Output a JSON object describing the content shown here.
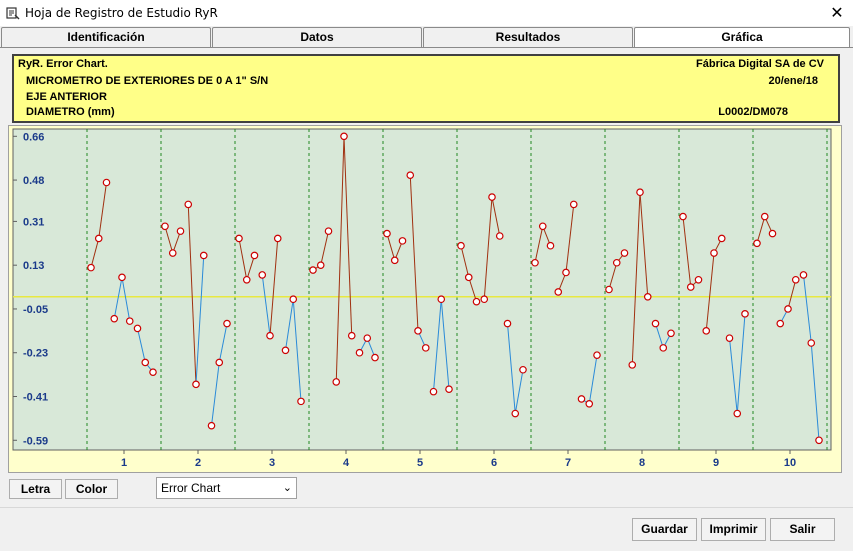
{
  "window": {
    "title": "Hoja de Registro de Estudio RyR",
    "close_glyph": "✕"
  },
  "tabs": [
    {
      "label": "Identificación",
      "active": false
    },
    {
      "label": "Datos",
      "active": false
    },
    {
      "label": "Resultados",
      "active": false
    },
    {
      "label": "Gráfica",
      "active": true
    }
  ],
  "header": {
    "chart_name": "RyR. Error Chart.",
    "company": "Fábrica Digital SA de CV",
    "instrument": "MICROMETRO DE EXTERIORES DE 0 A 1\" S/N",
    "date": "20/ene/18",
    "part": "EJE ANTERIOR",
    "characteristic": "DIAMETRO (mm)",
    "code": "L0002/DM078"
  },
  "chart_data": {
    "type": "line",
    "ylim": [
      -0.63,
      0.69
    ],
    "y_ticks": [
      "0.66",
      "0.48",
      "0.31",
      "0.13",
      "-0.05",
      "-0.23",
      "-0.41",
      "-0.59"
    ],
    "y_tick_values": [
      0.66,
      0.48,
      0.31,
      0.13,
      -0.05,
      -0.23,
      -0.41,
      -0.59
    ],
    "categories": [
      "1",
      "2",
      "3",
      "4",
      "5",
      "6",
      "7",
      "8",
      "9",
      "10"
    ],
    "center_line": 0.0,
    "colors": {
      "upper": "#a03010",
      "lower": "#2a8ad8",
      "marker": "#cc0000",
      "center": "#e8e840",
      "divider": "#228822",
      "plot_bg": "#d8e8d8",
      "outer_bg": "#ffffcc"
    },
    "parts": [
      {
        "part": "1",
        "operators": [
          [
            0.12,
            0.24,
            0.47
          ],
          [
            -0.09,
            0.08,
            -0.1
          ],
          [
            -0.13,
            -0.27,
            -0.31
          ]
        ]
      },
      {
        "part": "2",
        "operators": [
          [
            0.29,
            0.18,
            0.27
          ],
          [
            0.38,
            -0.36,
            0.17
          ],
          [
            -0.53,
            -0.27,
            -0.11
          ]
        ]
      },
      {
        "part": "3",
        "operators": [
          [
            0.24,
            0.07,
            0.17
          ],
          [
            0.09,
            -0.16,
            0.24
          ],
          [
            -0.22,
            -0.01,
            -0.43
          ]
        ]
      },
      {
        "part": "4",
        "operators": [
          [
            0.11,
            0.13,
            0.27
          ],
          [
            -0.35,
            0.66,
            -0.16
          ],
          [
            -0.23,
            -0.17,
            -0.25
          ]
        ]
      },
      {
        "part": "5",
        "operators": [
          [
            0.26,
            0.15,
            0.23
          ],
          [
            0.5,
            -0.14,
            -0.21
          ],
          [
            -0.39,
            -0.01,
            -0.38
          ]
        ]
      },
      {
        "part": "6",
        "operators": [
          [
            0.21,
            0.08,
            -0.02
          ],
          [
            -0.01,
            0.41,
            0.25
          ],
          [
            -0.11,
            -0.48,
            -0.3
          ]
        ]
      },
      {
        "part": "7",
        "operators": [
          [
            0.14,
            0.29,
            0.21
          ],
          [
            0.02,
            0.1,
            0.38
          ],
          [
            -0.42,
            -0.44,
            -0.24
          ]
        ]
      },
      {
        "part": "8",
        "operators": [
          [
            0.03,
            0.14,
            0.18
          ],
          [
            -0.28,
            0.43,
            0.0
          ],
          [
            -0.11,
            -0.21,
            -0.15
          ]
        ]
      },
      {
        "part": "9",
        "operators": [
          [
            0.33,
            0.04,
            0.07
          ],
          [
            -0.14,
            0.18,
            0.24
          ],
          [
            -0.17,
            -0.48,
            -0.07
          ]
        ]
      },
      {
        "part": "10",
        "operators": [
          [
            0.22,
            0.33,
            0.26
          ],
          [
            -0.11,
            -0.05,
            0.07
          ],
          [
            0.09,
            -0.19,
            -0.59
          ]
        ]
      }
    ]
  },
  "controls": {
    "letra_label": "Letra",
    "color_label": "Color",
    "chart_type_selected": "Error Chart",
    "guardar_label": "Guardar",
    "imprimir_label": "Imprimir",
    "salir_label": "Salir"
  }
}
